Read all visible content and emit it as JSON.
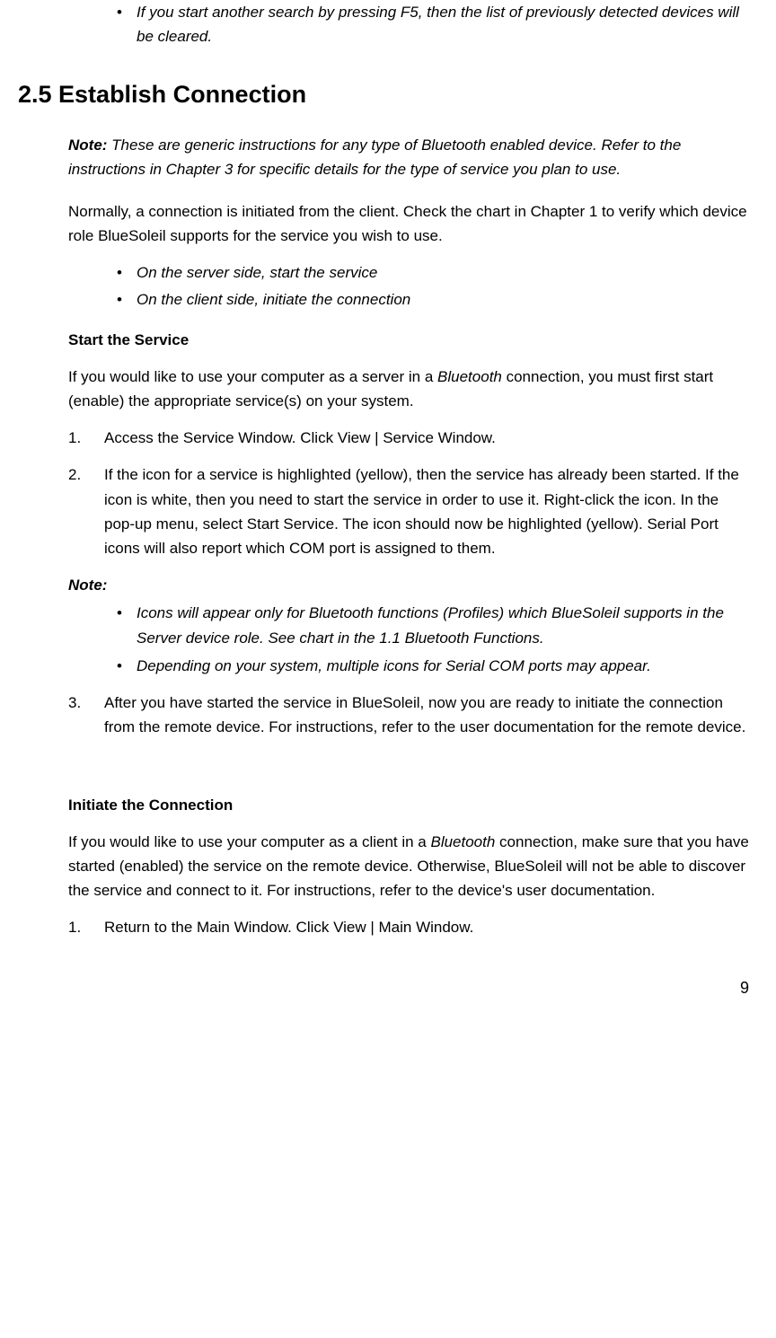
{
  "top_bullet": "If you start another search by pressing F5, then the list of previously detected devices will be cleared.",
  "heading": "2.5 Establish Connection",
  "note_label": "Note:",
  "note_text": " These are generic instructions for any type of Bluetooth enabled device. Refer to the instructions in Chapter 3 for specific details for the type of service you plan to use.",
  "intro_para": "Normally, a connection is initiated from the client. Check the chart in Chapter 1 to verify which device role BlueSoleil supports for the service you wish to use.",
  "intro_bullets": [
    "On the server side, start the service",
    "On the client side, initiate the connection"
  ],
  "start_heading": "Start the Service",
  "start_para_pre": "If you would like to use your computer as a server in a ",
  "start_para_italic": "Bluetooth",
  "start_para_post": " connection, you must first start (enable) the appropriate service(s) on your system.",
  "numbered1": [
    {
      "n": "1.",
      "t": "Access the Service Window. Click View | Service Window."
    },
    {
      "n": "2.",
      "t": "If the icon for a service is highlighted (yellow), then the service has already been started. If the icon is white, then you need to start the service in order to use it. Right-click the icon. In the pop-up menu, select Start Service. The icon should now be highlighted (yellow). Serial Port icons will also report which COM port is assigned to them."
    }
  ],
  "note2_label": "Note:",
  "note2_bullets": [
    "Icons will appear only for Bluetooth functions (Profiles) which BlueSoleil supports in the Server device role. See chart in the 1.1 Bluetooth Functions.",
    "Depending on your system, multiple icons for Serial COM ports may appear."
  ],
  "numbered2": [
    {
      "n": "3.",
      "t": "After you have started the service in BlueSoleil, now you are ready to initiate the connection from the remote device. For instructions, refer to the user documentation for the remote device."
    }
  ],
  "initiate_heading": "Initiate the Connection",
  "initiate_para_pre": "If you would like to use your computer as a client in a ",
  "initiate_para_italic": "Bluetooth",
  "initiate_para_post": " connection, make sure that you have started (enabled) the service on the remote device. Otherwise, BlueSoleil will not be able to discover the service and connect to it. For instructions, refer to the device's user documentation.",
  "numbered3": [
    {
      "n": "1.",
      "t": "Return to the Main Window. Click View | Main Window."
    }
  ],
  "page_number": "9"
}
